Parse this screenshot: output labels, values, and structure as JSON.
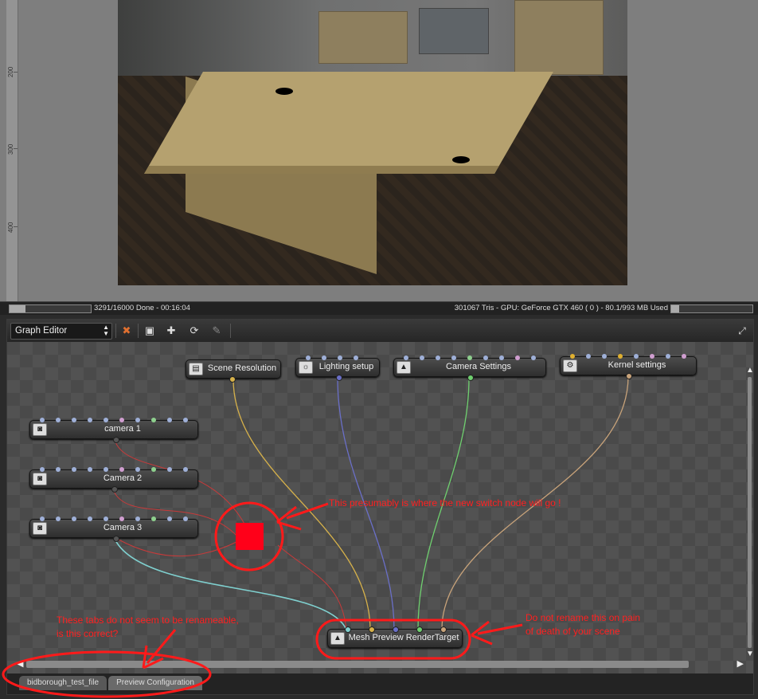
{
  "ruler": {
    "marks": [
      "200",
      "300",
      "400"
    ]
  },
  "status": {
    "progress_text": "3291/16000 Done - 00:16:04",
    "gpu_text": "301067 Tris - GPU: GeForce GTX 460 ( 0 ) - 80.1/993 MB Used",
    "render_progress": 0.2,
    "memory_progress": 0.1
  },
  "graph_editor": {
    "editor_type": "Graph Editor",
    "toolbar_icons": [
      "node-delete-icon",
      "render-target-icon",
      "camera-add-icon",
      "camera-toggle-icon",
      "brush-icon"
    ],
    "expand_icon": "expand-icon"
  },
  "nodes": {
    "scene_resolution": "Scene Resolution",
    "lighting_setup": "Lighting setup",
    "camera_settings": "Camera Settings",
    "kernel_settings": "Kernel settings",
    "camera_1": "camera 1",
    "camera_2": "Camera 2",
    "camera_3": "Camera 3",
    "render_target": "Mesh Preview RenderTarget"
  },
  "tabs": [
    "bidborough_test_file",
    "Preview Configuration"
  ],
  "annotations": {
    "switch_note": "This presumably is where the new switch node will go !",
    "tabs_note_1": "These tabs do not seem to be renameable,",
    "tabs_note_2": "is this  correct?",
    "rename_note_1": "Do not rename this on pain",
    "rename_note_2": "of death of your scene"
  },
  "colors": {
    "annotation": "#ff2020",
    "wire_yellow": "#d6b14a",
    "wire_blue": "#6a6fc8",
    "wire_green": "#6fd06f",
    "wire_tan": "#c8a37a",
    "wire_cyan": "#7fd0cf",
    "wire_red": "#c83a3a"
  }
}
